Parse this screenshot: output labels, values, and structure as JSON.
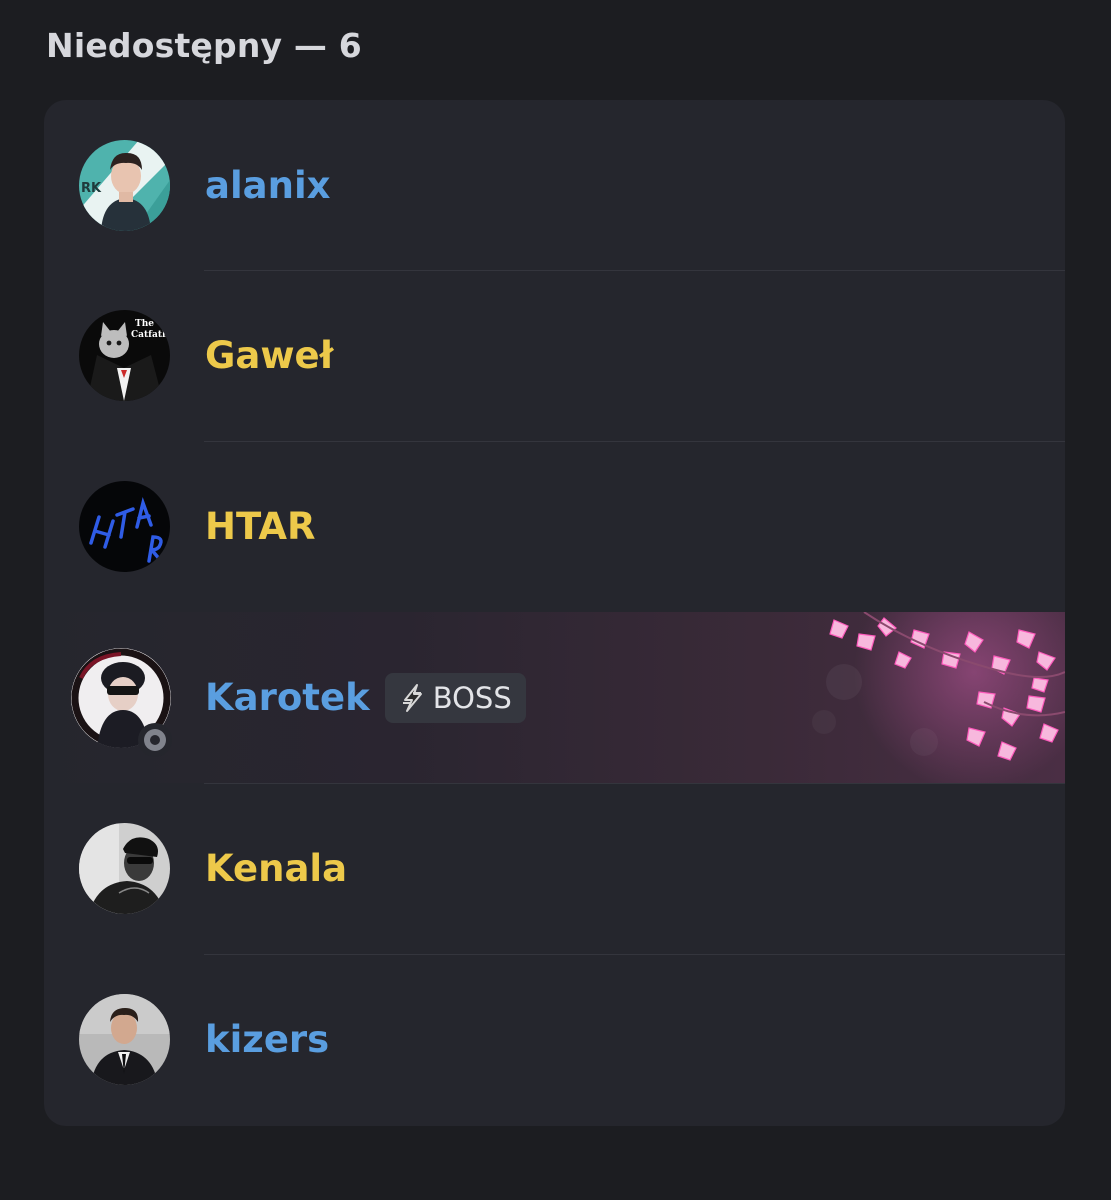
{
  "section": {
    "title": "Niedostępny — 6"
  },
  "members": [
    {
      "name": "alanix",
      "name_color": "#5a9ee0",
      "avatar": "person-photo-teal-background"
    },
    {
      "name": "Gaweł",
      "name_color": "#edc94a",
      "avatar": "cat-in-suit-the-catfather"
    },
    {
      "name": "HTAR",
      "name_color": "#edc94a",
      "avatar": "blue-htar-lettering"
    },
    {
      "name": "Karotek",
      "name_color": "#5a9ee0",
      "avatar": "person-sunglasses-ink-frame",
      "status": "offline",
      "role_badge": {
        "icon": "lightning-icon",
        "label": "BOSS"
      },
      "profile_banner": "pink-cherry-blossom"
    },
    {
      "name": "Kenala",
      "name_color": "#edc94a",
      "avatar": "person-black-white-photo"
    },
    {
      "name": "kizers",
      "name_color": "#5a9ee0",
      "avatar": "man-in-suit-photo"
    }
  ]
}
